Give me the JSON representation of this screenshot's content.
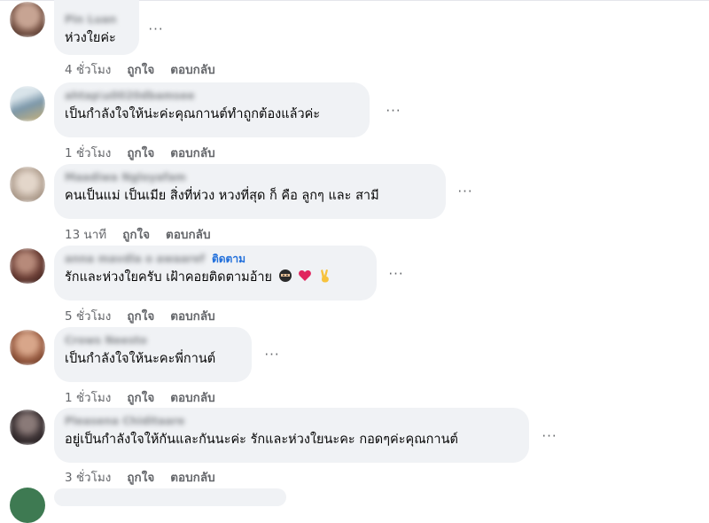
{
  "comments": [
    {
      "author": "Pin Luan",
      "text": "ห่วงใยค่ะ",
      "time": "4 ชั่วโมง",
      "like": "ถูกใจ",
      "reply": "ตอบกลับ",
      "avatar_color": "#8b6a5a"
    },
    {
      "author": "ahtap\\u0020dbamsee",
      "text": "เป็นกำลังใจให้น่ะค่ะคุณกานต์ทำถูกต้องแล้วค่ะ",
      "time": "1 ชั่วโมง",
      "like": "ถูกใจ",
      "reply": "ตอบกลับ",
      "avatar_color": "#6c8aa0"
    },
    {
      "author": "Maadiwa Ngloyafam",
      "text": "คนเป็นแม่ เป็นเมีย สิ่งที่ห่วง หวงที่สุด ก็ คือ ลูกๆ และ สามี",
      "time": "13 นาที",
      "like": "ถูกใจ",
      "reply": "ตอบกลับ",
      "avatar_color": "#b8aa9c"
    },
    {
      "author": "anna mavdla o awaaref",
      "follow": "ติดตาม",
      "text": "รักและห่วงใยครับ เฝ้าคอยติดตามอ้าย",
      "time": "5 ชั่วโมง",
      "like": "ถูกใจ",
      "reply": "ตอบกลับ",
      "avatar_color": "#5a3a34"
    },
    {
      "author": "Crows Neesto",
      "text": "เป็นกำลังใจให้นะคะพี่กานต์",
      "time": "1 ชั่วโมง",
      "like": "ถูกใจ",
      "reply": "ตอบกลับ",
      "avatar_color": "#9a6248"
    },
    {
      "author": "Pleasena Chiditaare",
      "text": "อยู่เป็นกำลังใจให้กันและกันนะค่ะ รักและห่วงใยนะคะ กอดๆค่ะคุณกานต์",
      "time": "3 ชั่วโมง",
      "like": "ถูกใจ",
      "reply": "ตอบกลับ",
      "avatar_color": "#3a3032"
    }
  ],
  "more_label": "···",
  "emoji_names": [
    "ninja-emoji",
    "red-heart-emoji",
    "victory-hand-emoji"
  ]
}
